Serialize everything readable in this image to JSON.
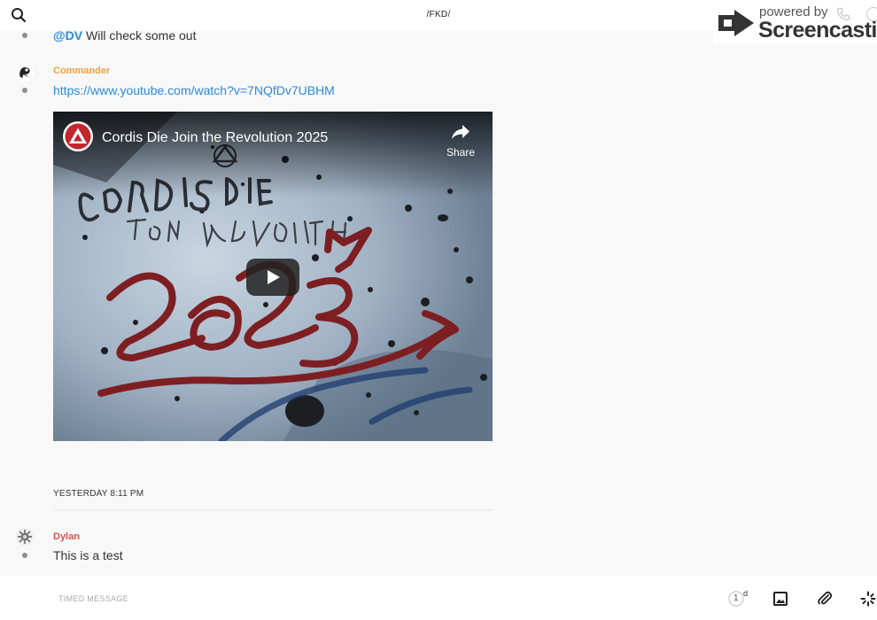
{
  "header": {
    "title": "/FKD/",
    "search_icon": "search-icon",
    "phone_icon": "phone-icon",
    "info_icon": "info-icon"
  },
  "watermark": {
    "powered_by": "powered by",
    "brand": "Screencastify"
  },
  "messages": [
    {
      "mention": "@DV",
      "text": " Will check some out"
    },
    {
      "author": "Commander",
      "author_color": "#f0a040",
      "link": "https://www.youtube.com/watch?v=7NQfDv7UBHM",
      "video": {
        "title": "Cordis Die Join the Revolution 2025",
        "share_label": "Share"
      }
    },
    {
      "author": "Dylan",
      "author_color": "#d9534f",
      "text": "This is a test"
    }
  ],
  "timestamp": "YESTERDAY 8:11 PM",
  "composer": {
    "placeholder": "TIMED MESSAGE",
    "timer_value": "1",
    "timer_unit": "d"
  },
  "colors": {
    "link": "#2a8ae0",
    "background": "#f8f8f8"
  }
}
